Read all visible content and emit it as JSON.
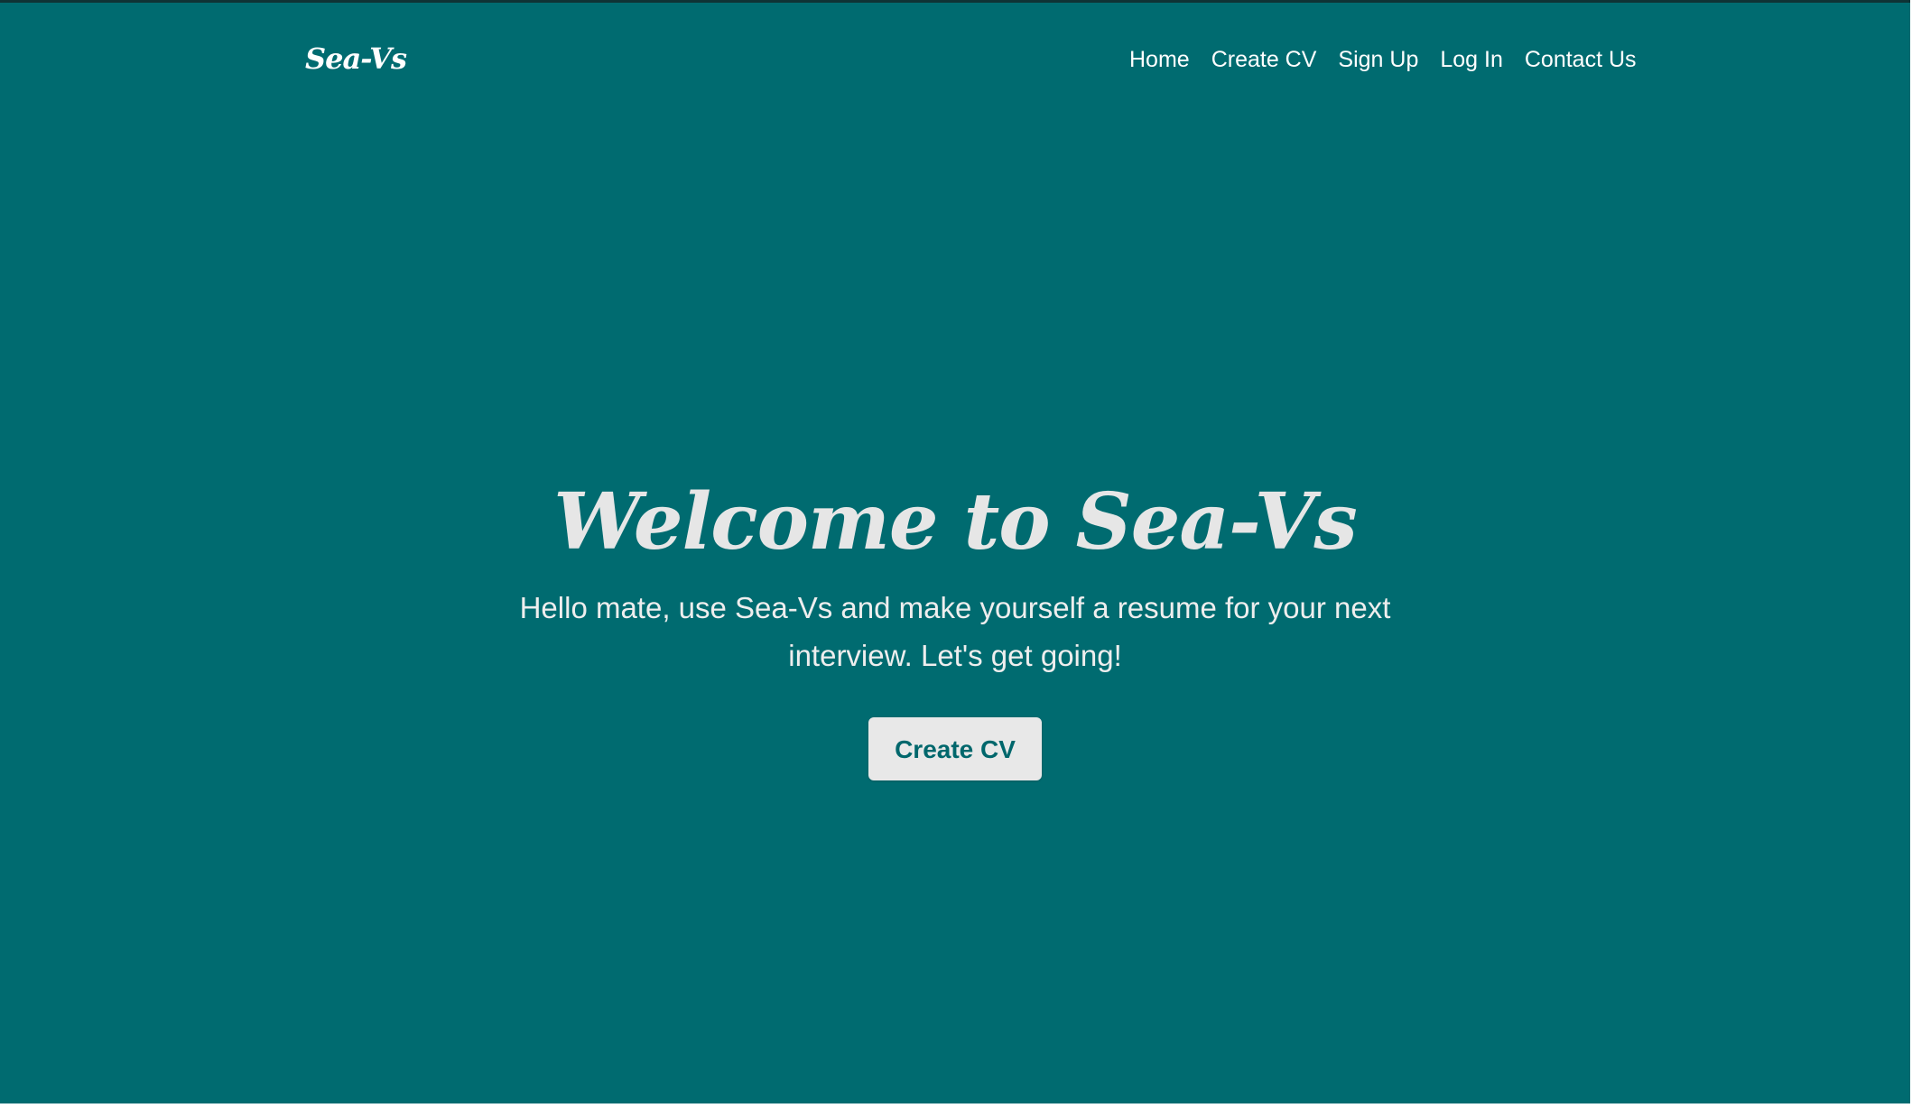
{
  "header": {
    "logo": "Sea-Vs",
    "nav": [
      {
        "label": "Home"
      },
      {
        "label": "Create CV"
      },
      {
        "label": "Sign Up"
      },
      {
        "label": "Log In"
      },
      {
        "label": "Contact Us"
      }
    ]
  },
  "hero": {
    "title": "Welcome to Sea-Vs",
    "subtitle": "Hello mate, use Sea-Vs and make yourself a resume for your next interview. Let's get going!",
    "button_label": "Create CV"
  },
  "colors": {
    "background": "#006b70",
    "text": "#ffffff",
    "button_bg": "#e8e8e8",
    "button_text": "#00676c"
  }
}
